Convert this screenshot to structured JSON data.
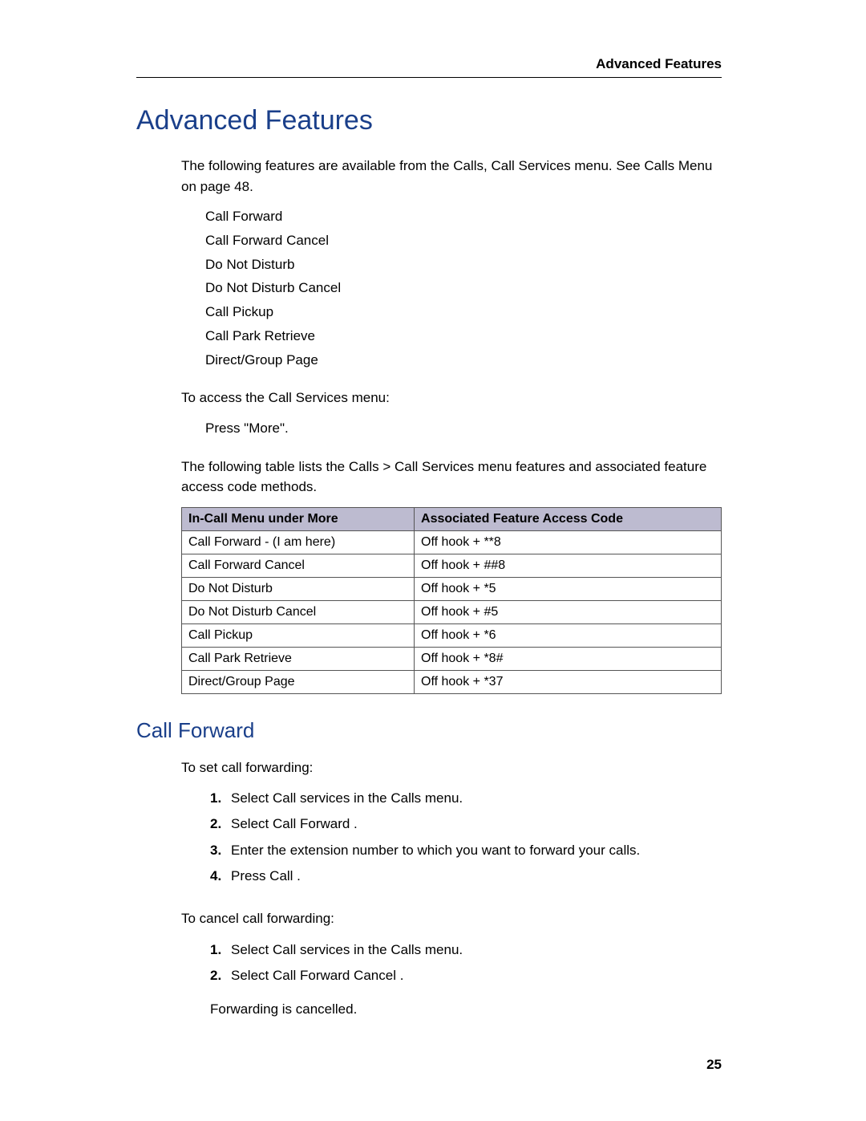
{
  "header": {
    "running": "Advanced Features"
  },
  "title": "Advanced Features",
  "intro": "The following features are available from the Calls, Call Services menu. See  Calls Menu  on page 48.",
  "featureList": [
    "Call Forward",
    "Call Forward Cancel",
    "Do Not Disturb",
    "Do Not Disturb Cancel",
    "Call Pickup",
    "Call Park Retrieve",
    "Direct/Group Page"
  ],
  "accessLead": "To access the Call Services menu:",
  "accessStep": "Press \"More\".",
  "tableLead": "The following table lists the Calls > Call Services menu features and associated feature access code methods.",
  "table": {
    "head": {
      "c1": "In-Call Menu under More",
      "c2": "Associated Feature Access Code"
    },
    "rows": [
      {
        "c1": "Call Forward - (I am here)",
        "c2": "Off hook + **8"
      },
      {
        "c1": "Call Forward Cancel",
        "c2": "Off hook + ##8"
      },
      {
        "c1": "Do Not Disturb",
        "c2": "Off hook + *5"
      },
      {
        "c1": "Do Not Disturb Cancel",
        "c2": "Off hook + #5"
      },
      {
        "c1": "Call Pickup",
        "c2": "Off hook + *6"
      },
      {
        "c1": "Call Park Retrieve",
        "c2": "Off hook + *8#"
      },
      {
        "c1": "Direct/Group Page",
        "c2": "Off hook + *37"
      }
    ]
  },
  "section2": {
    "title": "Call Forward",
    "setLead": "To set call forwarding:",
    "setSteps": [
      "Select  Call services  in the  Calls  menu.",
      "Select  Call Forward .",
      "Enter the extension number to which you want to forward your calls.",
      "Press  Call ."
    ],
    "cancelLead": "To cancel call forwarding:",
    "cancelSteps": [
      "Select  Call services  in the  Calls  menu.",
      "Select  Call Forward Cancel ."
    ],
    "cancelTrail": "Forwarding is cancelled."
  },
  "pageNumber": "25"
}
